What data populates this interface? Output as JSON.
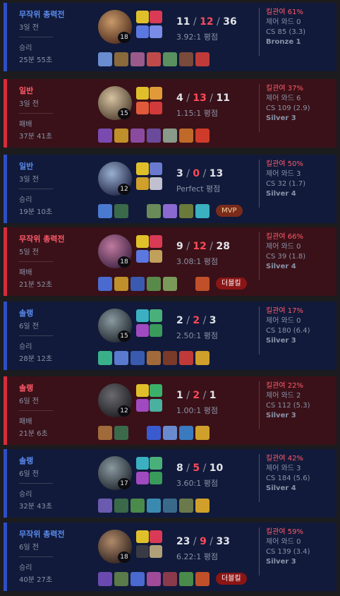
{
  "matches": [
    {
      "result_class": "win",
      "mode": "무작위 총력전",
      "ago": "3일 전",
      "result": "승리",
      "duration": "25분 55초",
      "level": "18",
      "k": "11",
      "d": "12",
      "a": "36",
      "ratio": "3.92:1 평점",
      "kp": "킬관여 61%",
      "wards": "제어 와드 0",
      "cs": "CS 85 (3.3)",
      "tier": "Bronze 1",
      "badge": "",
      "badge_type": "",
      "champ_colors": [
        "#c89a6a",
        "#5a3624"
      ],
      "spell_colors": [
        "#e0c02a",
        "#d93a55",
        "#5a78e0",
        "#7a8ce6"
      ],
      "item_colors": [
        "#6a8cd0",
        "#8a6a3a",
        "#9a5a8a",
        "#c04a4a",
        "#5a9060",
        "#7a4a3a",
        "#c03a3a"
      ]
    },
    {
      "result_class": "lose",
      "mode": "일반",
      "ago": "3일 전",
      "result": "패배",
      "duration": "37분 41초",
      "level": "15",
      "k": "4",
      "d": "13",
      "a": "11",
      "ratio": "1.15:1 평점",
      "kp": "킬관여 37%",
      "wards": "제어 와드 6",
      "cs": "CS 109 (2.9)",
      "tier": "Silver 3",
      "badge": "",
      "badge_type": "",
      "champ_colors": [
        "#d6c2a0",
        "#5a4a3a"
      ],
      "spell_colors": [
        "#e0c02a",
        "#e09a3a",
        "#e05a3a",
        "#d03a3a"
      ],
      "item_colors": [
        "#7a4ab0",
        "#c0902a",
        "#8a4aa0",
        "#6a4a9a",
        "#8a9a8a",
        "#c06a2a",
        "#d03a2a"
      ]
    },
    {
      "result_class": "win",
      "mode": "일반",
      "ago": "3일 전",
      "result": "승리",
      "duration": "19분 10초",
      "level": "12",
      "k": "3",
      "d": "0",
      "a": "13",
      "ratio": "Perfect 평점",
      "kp": "킬관여 50%",
      "wards": "제어 와드 3",
      "cs": "CS 32 (1.7)",
      "tier": "Silver 4",
      "badge": "MVP",
      "badge_type": "mvp",
      "champ_colors": [
        "#9ab0d0",
        "#2a3050"
      ],
      "spell_colors": [
        "#e0c02a",
        "#6a7ad0",
        "#d0a02a",
        "#c0c0d0"
      ],
      "item_colors": [
        "#4a7ad0",
        "#3a6a4a",
        "#1a1a24",
        "#6a8a5a",
        "#8a6ad0",
        "#6a7a3a",
        "#3ab0c0"
      ]
    },
    {
      "result_class": "lose",
      "mode": "무작위 총력전",
      "ago": "5일 전",
      "result": "패배",
      "duration": "21분 52초",
      "level": "18",
      "k": "9",
      "d": "12",
      "a": "28",
      "ratio": "3.08:1 평점",
      "kp": "킬관여 66%",
      "wards": "제어 와드 0",
      "cs": "CS 39 (1.8)",
      "tier": "Silver 4",
      "badge": "더블킬",
      "badge_type": "multi",
      "champ_colors": [
        "#c07aa0",
        "#4a2a4a"
      ],
      "spell_colors": [
        "#e0c02a",
        "#d93a55",
        "#5a78e0",
        "#c0a05a"
      ],
      "item_colors": [
        "#4a6ad0",
        "#c0902a",
        "#3a5ab0",
        "#5a8a4a",
        "#7a9a5a",
        "#1a1a24",
        "#c0502a"
      ]
    },
    {
      "result_class": "win",
      "mode": "솔랭",
      "ago": "6일 전",
      "result": "승리",
      "duration": "28분 12초",
      "level": "15",
      "k": "2",
      "d": "2",
      "a": "3",
      "ratio": "2.50:1 평점",
      "kp": "킬관여 17%",
      "wards": "제어 와드 0",
      "cs": "CS 180 (6.4)",
      "tier": "Silver 3",
      "badge": "",
      "badge_type": "",
      "champ_colors": [
        "#8a9aa0",
        "#2a3038"
      ],
      "spell_colors": [
        "#3ab0c0",
        "#4ab07a",
        "#a04ac0",
        "#3a9a5a"
      ],
      "item_colors": [
        "#3ab08a",
        "#5a7ad0",
        "#3a5ab0",
        "#a06a3a",
        "#7a3a2a",
        "#c03a3a",
        "#d0a02a"
      ]
    },
    {
      "result_class": "lose",
      "mode": "솔랭",
      "ago": "6일 전",
      "result": "패배",
      "duration": "21분 6초",
      "level": "12",
      "k": "1",
      "d": "2",
      "a": "1",
      "ratio": "1.00:1 평점",
      "kp": "킬관여 22%",
      "wards": "제어 와드 2",
      "cs": "CS 112 (5.3)",
      "tier": "Silver 3",
      "badge": "",
      "badge_type": "",
      "champ_colors": [
        "#6a6a70",
        "#242428"
      ],
      "spell_colors": [
        "#e0c02a",
        "#3ab06a",
        "#a04ac0",
        "#4ab0a0"
      ],
      "item_colors": [
        "#a06a3a",
        "#3a6a4a",
        "#1a1a24",
        "#3a5ad0",
        "#6a8ad0",
        "#3a7ac0",
        "#d0a02a"
      ]
    },
    {
      "result_class": "win",
      "mode": "솔랭",
      "ago": "6일 전",
      "result": "승리",
      "duration": "32분 43초",
      "level": "17",
      "k": "8",
      "d": "5",
      "a": "10",
      "ratio": "3.60:1 평점",
      "kp": "킬관여 42%",
      "wards": "제어 와드 3",
      "cs": "CS 184 (5.6)",
      "tier": "Silver 4",
      "badge": "",
      "badge_type": "",
      "champ_colors": [
        "#8a9aa0",
        "#2a3038"
      ],
      "spell_colors": [
        "#3ab0c0",
        "#4ab07a",
        "#a04ac0",
        "#3a9a5a"
      ],
      "item_colors": [
        "#6a5ab0",
        "#3a6a4a",
        "#4a8a4a",
        "#3a8ab0",
        "#3a6a8a",
        "#6a7a4a",
        "#d0a02a"
      ]
    },
    {
      "result_class": "win",
      "mode": "무작위 총력전",
      "ago": "6일 전",
      "result": "승리",
      "duration": "40분 27초",
      "level": "18",
      "k": "23",
      "d": "9",
      "a": "33",
      "ratio": "6.22:1 평점",
      "kp": "킬관여 59%",
      "wards": "제어 와드 0",
      "cs": "CS 139 (3.4)",
      "tier": "Silver 3",
      "badge": "더블킬",
      "badge_type": "multi",
      "champ_colors": [
        "#b08a6a",
        "#3a2a24"
      ],
      "spell_colors": [
        "#e0c02a",
        "#d93a55",
        "#3a3a44",
        "#b0a07a"
      ],
      "item_colors": [
        "#6a4ab0",
        "#5a7a4a",
        "#4a6ad0",
        "#a04a9a",
        "#8a3a4a",
        "#4a8a4a",
        "#c0502a"
      ]
    }
  ]
}
